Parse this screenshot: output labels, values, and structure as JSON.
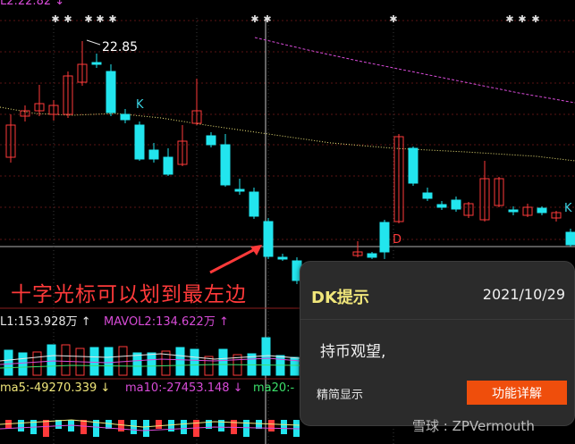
{
  "chart": {
    "top_label": "L2:22.82 ↓",
    "peak_label": "22.85",
    "k_label": "K",
    "d_label": "D",
    "annotation": "十字光标可以划到最左边"
  },
  "volume": {
    "mavol1": "L1:153.928万 ↑",
    "mavol2": "MAVOL2:134.622万 ↑"
  },
  "indicator": {
    "ma5": "ma5:-49270.339 ↓",
    "ma10": "ma10:-27453.148 ↓",
    "ma20": "ma20:-"
  },
  "dk_panel": {
    "title": "DK提示",
    "date": "2021/10/29",
    "message": "持币观望,",
    "toggle_label": "精简显示",
    "detail_button": "功能详解"
  },
  "watermark": "雪球 : ZPVermouth",
  "colors": {
    "up": "#ff3a3a",
    "down": "#22e5ee",
    "magenta": "#d74bd7",
    "yellow": "#f0e67a",
    "green": "#3be06a",
    "accent_button": "#ef4e0c"
  }
}
